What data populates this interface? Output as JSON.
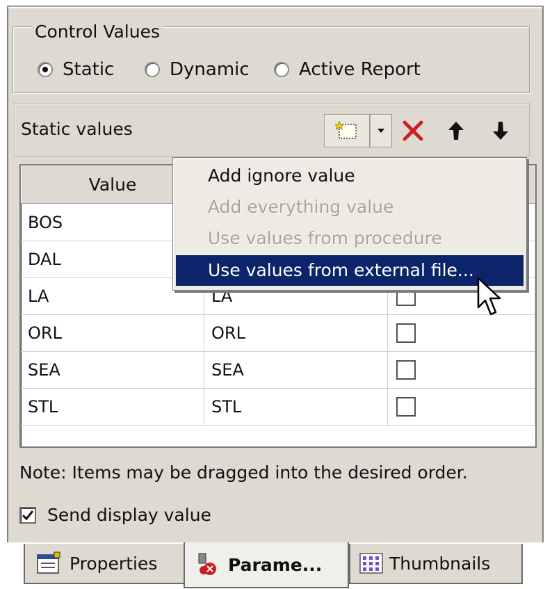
{
  "control_values": {
    "legend": "Control Values",
    "options": [
      {
        "label": "Static",
        "selected": true
      },
      {
        "label": "Dynamic",
        "selected": false
      },
      {
        "label": "Active Report",
        "selected": false
      }
    ]
  },
  "static_values": {
    "label": "Static values",
    "toolbar": [
      {
        "icon": "new-value-icon"
      },
      {
        "icon": "dropdown-arrow-icon"
      },
      {
        "icon": "delete-x-icon",
        "color": "#cc2020"
      },
      {
        "icon": "move-up-icon"
      },
      {
        "icon": "move-down-icon"
      }
    ]
  },
  "table": {
    "columns": [
      "Value",
      "",
      ""
    ],
    "rows": [
      {
        "value": "BOS",
        "display": ""
      },
      {
        "value": "DAL",
        "display": ""
      },
      {
        "value": "LA",
        "display": "LA"
      },
      {
        "value": "ORL",
        "display": "ORL"
      },
      {
        "value": "SEA",
        "display": "SEA"
      },
      {
        "value": "STL",
        "display": "STL"
      }
    ]
  },
  "menu": {
    "items": [
      {
        "label": "Add ignore value",
        "enabled": true,
        "highlighted": false
      },
      {
        "label": "Add everything value",
        "enabled": false,
        "highlighted": false
      },
      {
        "label": "Use values from procedure",
        "enabled": false,
        "highlighted": false
      },
      {
        "label": "Use values from external file...",
        "enabled": true,
        "highlighted": true
      }
    ],
    "highlight_color": "#0b246a"
  },
  "note": "Note:  Items may be dragged into the desired order.",
  "send_display": {
    "label": "Send display value",
    "checked": true
  },
  "tabs": [
    {
      "label": "Properties",
      "icon": "properties-icon",
      "active": false
    },
    {
      "label": "Parame...",
      "icon": "parameters-icon",
      "active": true
    },
    {
      "label": "Thumbnails",
      "icon": "thumbnails-icon",
      "active": false
    }
  ]
}
